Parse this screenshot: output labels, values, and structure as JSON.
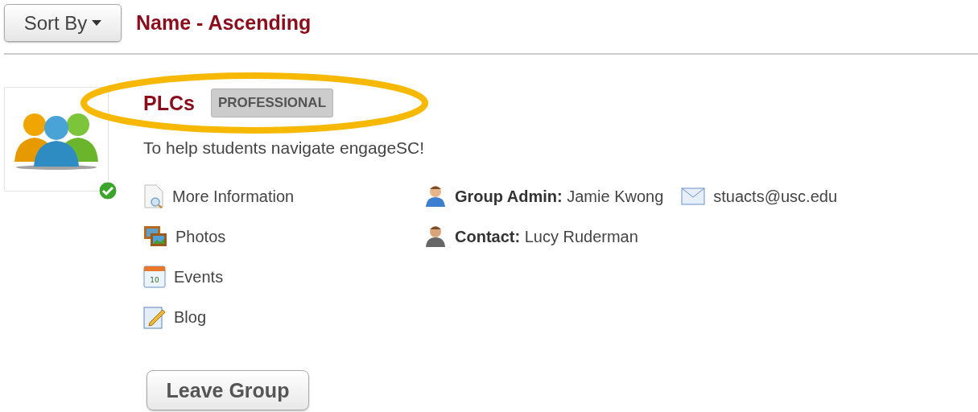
{
  "sort": {
    "button": "Sort By",
    "value": "Name - Ascending"
  },
  "group": {
    "name": "PLCs",
    "badge": "PROFESSIONAL",
    "description": "To help students navigate engageSC!",
    "verified": true
  },
  "links": [
    {
      "kind": "info",
      "label": "More Information"
    },
    {
      "kind": "photos",
      "label": "Photos"
    },
    {
      "kind": "events",
      "label": "Events",
      "icon_text": "10"
    },
    {
      "kind": "blog",
      "label": "Blog"
    }
  ],
  "contacts": [
    {
      "kind": "admin",
      "label": "Group Admin:",
      "name": "Jamie Kwong",
      "email": "stuacts@usc.edu"
    },
    {
      "kind": "contact",
      "label": "Contact:",
      "name": "Lucy Ruderman"
    }
  ],
  "action": "Leave Group"
}
